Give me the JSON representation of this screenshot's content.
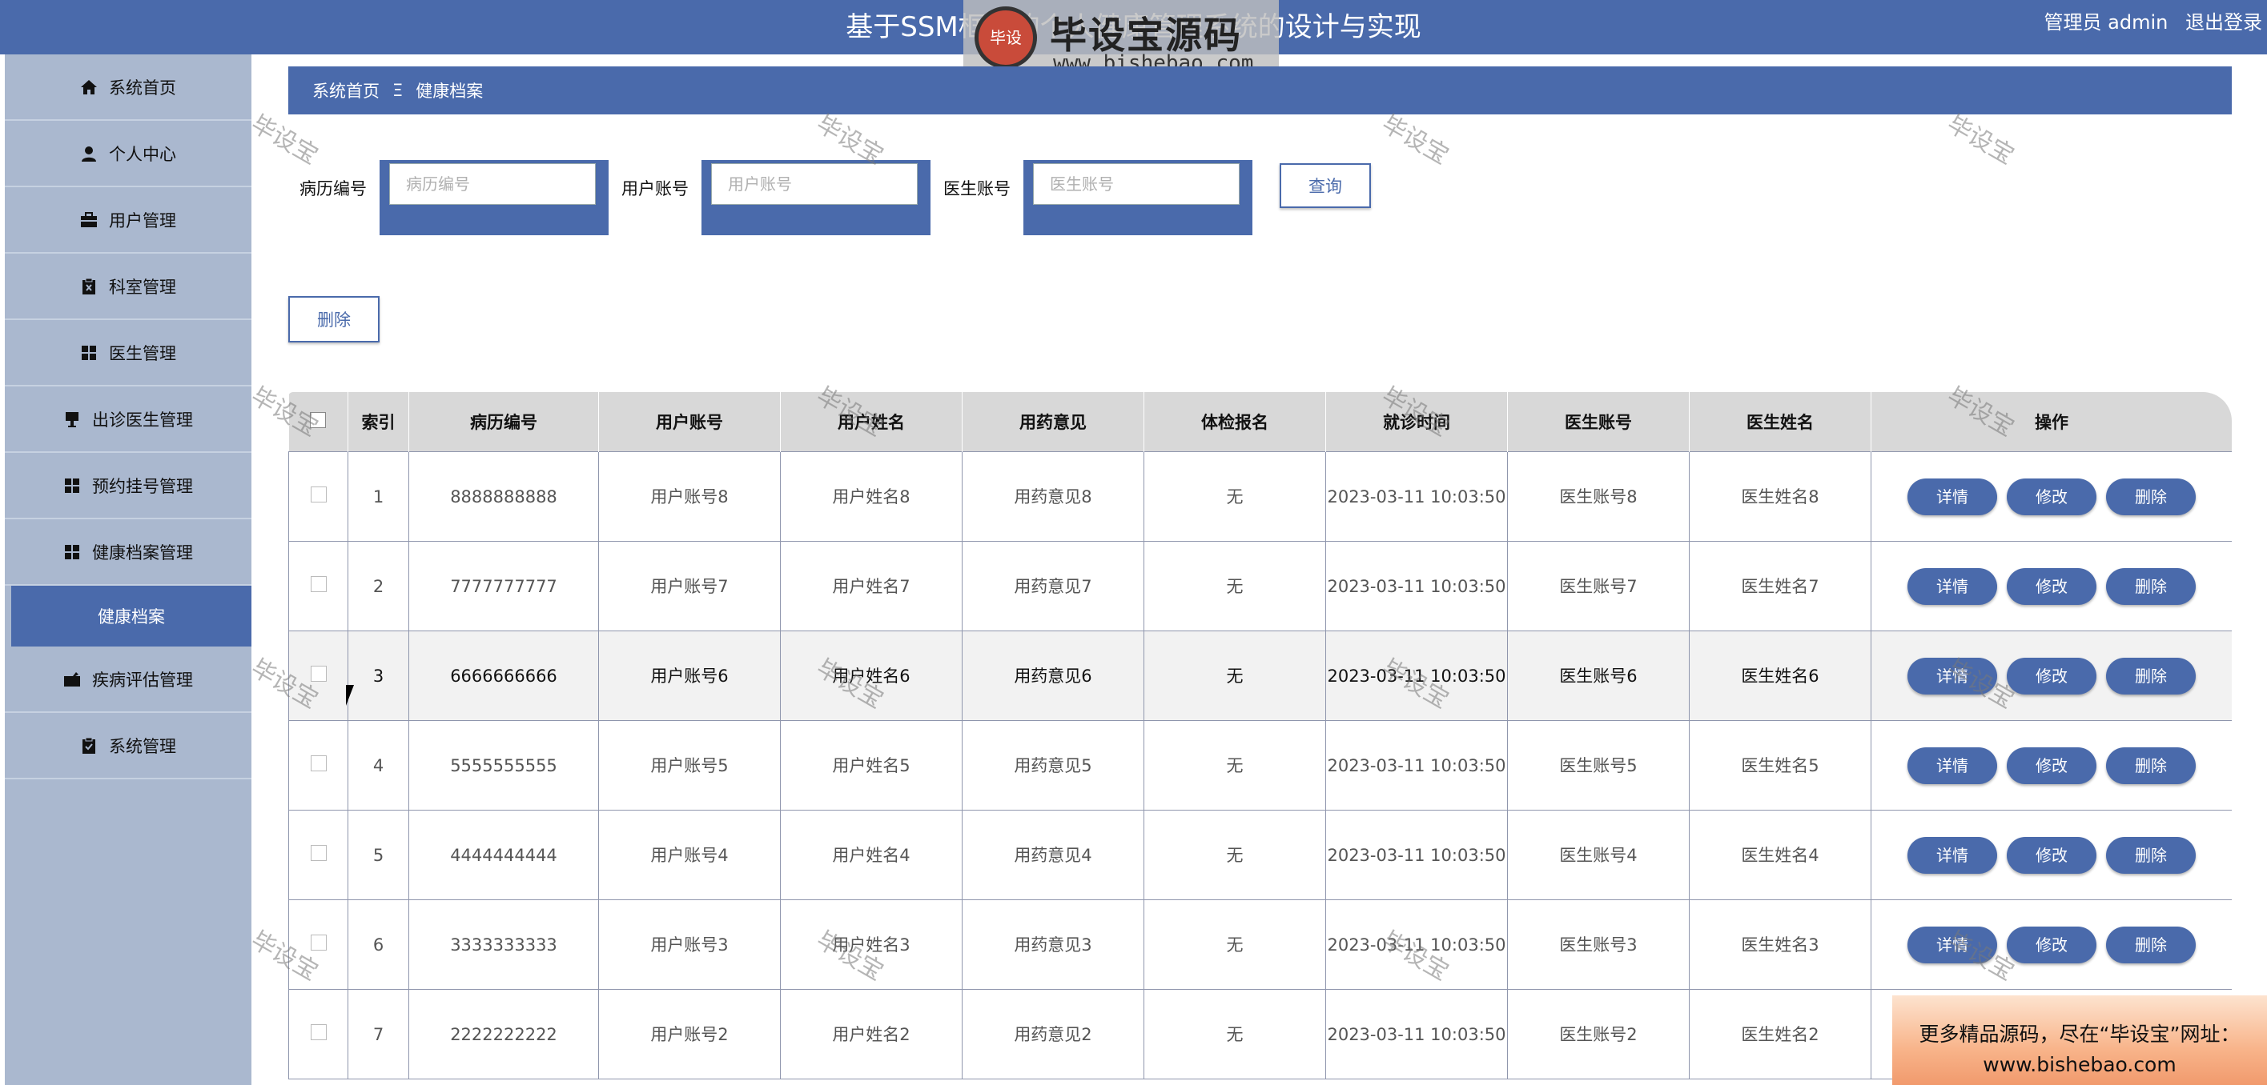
{
  "header": {
    "title": "基于SSM框架的个人健康管理系统的设计与实现",
    "user_label": "管理员 admin",
    "logout_label": "退出登录"
  },
  "logo": {
    "text": "毕设宝源码网",
    "url": "www.bishebao.com",
    "badge": "毕设"
  },
  "sidebar": {
    "items": [
      {
        "label": "系统首页",
        "icon": "home-icon"
      },
      {
        "label": "个人中心",
        "icon": "person-icon"
      },
      {
        "label": "用户管理",
        "icon": "briefcase-icon"
      },
      {
        "label": "科室管理",
        "icon": "clipboard-x-icon"
      },
      {
        "label": "医生管理",
        "icon": "grid-icon"
      },
      {
        "label": "出诊医生管理",
        "icon": "monitor-icon"
      },
      {
        "label": "预约挂号管理",
        "icon": "grid-icon"
      },
      {
        "label": "健康档案管理",
        "icon": "grid-icon"
      },
      {
        "label": "健康档案",
        "icon": "",
        "active": true
      },
      {
        "label": "疾病评估管理",
        "icon": "briefcase-icon"
      },
      {
        "label": "系统管理",
        "icon": "clipboard-check-icon"
      }
    ]
  },
  "breadcrumb": {
    "home": "系统首页",
    "separator": "Ξ",
    "current": "健康档案"
  },
  "search": {
    "case_no_label": "病历编号",
    "case_no_placeholder": "病历编号",
    "user_account_label": "用户账号",
    "user_account_placeholder": "用户账号",
    "doctor_account_label": "医生账号",
    "doctor_account_placeholder": "医生账号",
    "query_label": "查询"
  },
  "actions": {
    "delete_label": "删除"
  },
  "table": {
    "headers": [
      "索引",
      "病历编号",
      "用户账号",
      "用户姓名",
      "用药意见",
      "体检报名",
      "就诊时间",
      "医生账号",
      "医生姓名",
      "操作"
    ],
    "op_labels": {
      "detail": "详情",
      "edit": "修改",
      "delete": "删除"
    },
    "rows": [
      {
        "index": "1",
        "case_no": "8888888888",
        "user_account": "用户账号8",
        "user_name": "用户姓名8",
        "medication": "用药意见8",
        "report": "无",
        "time": "2023-03-11 10:03:50",
        "doctor_account": "医生账号8",
        "doctor_name": "医生姓名8"
      },
      {
        "index": "2",
        "case_no": "7777777777",
        "user_account": "用户账号7",
        "user_name": "用户姓名7",
        "medication": "用药意见7",
        "report": "无",
        "time": "2023-03-11 10:03:50",
        "doctor_account": "医生账号7",
        "doctor_name": "医生姓名7"
      },
      {
        "index": "3",
        "case_no": "6666666666",
        "user_account": "用户账号6",
        "user_name": "用户姓名6",
        "medication": "用药意见6",
        "report": "无",
        "time": "2023-03-11 10:03:50",
        "doctor_account": "医生账号6",
        "doctor_name": "医生姓名6"
      },
      {
        "index": "4",
        "case_no": "5555555555",
        "user_account": "用户账号5",
        "user_name": "用户姓名5",
        "medication": "用药意见5",
        "report": "无",
        "time": "2023-03-11 10:03:50",
        "doctor_account": "医生账号5",
        "doctor_name": "医生姓名5"
      },
      {
        "index": "5",
        "case_no": "4444444444",
        "user_account": "用户账号4",
        "user_name": "用户姓名4",
        "medication": "用药意见4",
        "report": "无",
        "time": "2023-03-11 10:03:50",
        "doctor_account": "医生账号4",
        "doctor_name": "医生姓名4"
      },
      {
        "index": "6",
        "case_no": "3333333333",
        "user_account": "用户账号3",
        "user_name": "用户姓名3",
        "medication": "用药意见3",
        "report": "无",
        "time": "2023-03-11 10:03:50",
        "doctor_account": "医生账号3",
        "doctor_name": "医生姓名3"
      },
      {
        "index": "7",
        "case_no": "2222222222",
        "user_account": "用户账号2",
        "user_name": "用户姓名2",
        "medication": "用药意见2",
        "report": "无",
        "time": "2023-03-11 10:03:50",
        "doctor_account": "医生账号2",
        "doctor_name": "医生姓名2"
      }
    ]
  },
  "watermark": "毕设宝",
  "promo": {
    "line1": "更多精品源码，尽在“毕设宝”网址：",
    "line2": "www.bishebao.com"
  },
  "colors": {
    "primary": "#4a6aab",
    "sidebar_bg": "#aab8cf",
    "header_row": "#d8d8d8"
  }
}
